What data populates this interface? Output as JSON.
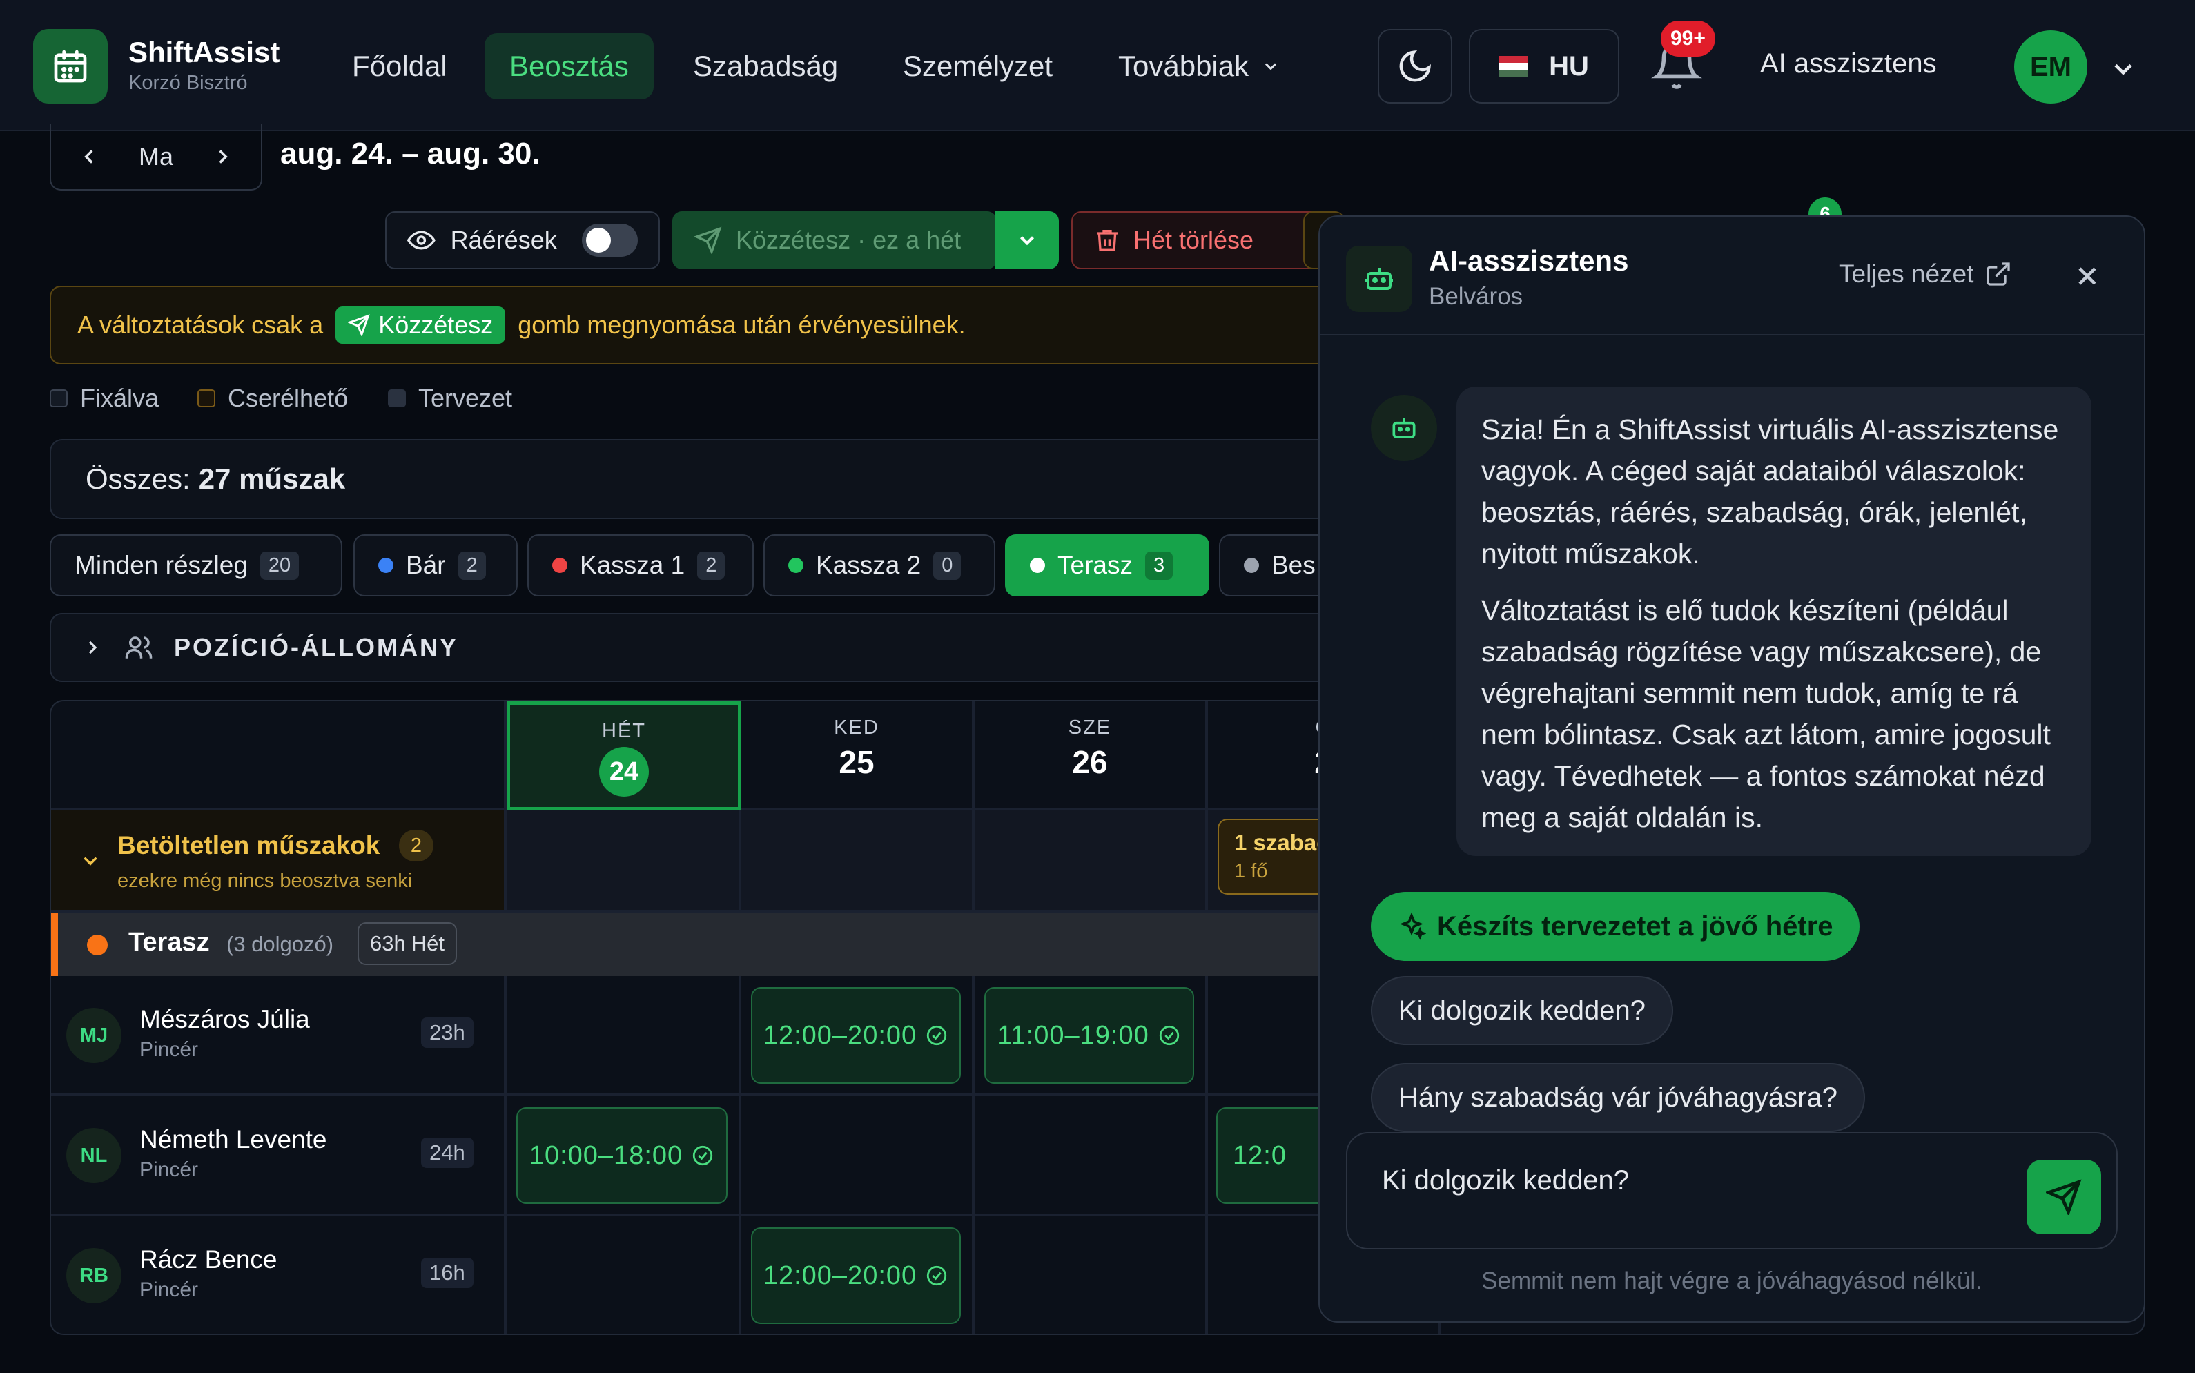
{
  "brand": {
    "name": "ShiftAssist",
    "subtitle": "Korzó Bisztró"
  },
  "nav": {
    "items": [
      {
        "label": "Főoldal"
      },
      {
        "label": "Beosztás",
        "active": true
      },
      {
        "label": "Szabadság"
      },
      {
        "label": "Személyzet"
      },
      {
        "label": "Továbbiak"
      }
    ],
    "language": "HU",
    "notifications_badge": "99+",
    "ai_link": "AI asszisztens",
    "avatar_initials": "EM"
  },
  "week": {
    "today_label": "Ma",
    "range": "aug. 24. – aug. 30."
  },
  "toolbar": {
    "availability": "Ráérések",
    "publish": "Közzétesz · ez a hét",
    "delete_week": "Hét törlése",
    "hidden_badge": "6"
  },
  "banner": {
    "before": "A változtatások csak a",
    "button": "Közzétesz",
    "after": "gomb megnyomása után érvényesülnek."
  },
  "legend": {
    "fixed": "Fixálva",
    "swappable": "Cserélhető",
    "draft": "Tervezet"
  },
  "summary": {
    "label": "Összes:",
    "value": "27 műszak"
  },
  "departments": [
    {
      "label": "Minden részleg",
      "count": "20"
    },
    {
      "label": "Bár",
      "count": "2",
      "color": "#3b82f6"
    },
    {
      "label": "Kassza 1",
      "count": "2",
      "color": "#ef4444"
    },
    {
      "label": "Kassza 2",
      "count": "0",
      "color": "#22c55e"
    },
    {
      "label": "Terasz",
      "count": "3",
      "color": "#ffffff",
      "active": true
    },
    {
      "label": "Bes",
      "color": "#9ca3af"
    }
  ],
  "position_section": {
    "label": "POZÍCIÓ-ÁLLOMÁNY"
  },
  "days": [
    {
      "name": "HÉT",
      "date": "24",
      "today": true
    },
    {
      "name": "KED",
      "date": "25"
    },
    {
      "name": "SZE",
      "date": "26"
    },
    {
      "name": "C",
      "date": "2"
    }
  ],
  "unfilled": {
    "title": "Betöltetlen műszakok",
    "count": "2",
    "subtitle": "ezekre még nincs beosztva senki",
    "card_title": "1 szabad",
    "card_sub": "1 fő"
  },
  "group": {
    "name": "Terasz",
    "staff": "(3 dolgozó)",
    "hours": "63h",
    "period": "Hét"
  },
  "employees": [
    {
      "initials": "MJ",
      "name": "Mészáros Júlia",
      "role": "Pincér",
      "hours": "23h",
      "shifts": [
        "",
        "12:00–20:00",
        "11:00–19:00",
        ""
      ]
    },
    {
      "initials": "NL",
      "name": "Németh Levente",
      "role": "Pincér",
      "hours": "24h",
      "shifts": [
        "10:00–18:00",
        "",
        "",
        "12:0"
      ]
    },
    {
      "initials": "RB",
      "name": "Rácz Bence",
      "role": "Pincér",
      "hours": "16h",
      "shifts": [
        "",
        "12:00–20:00",
        "",
        ""
      ]
    }
  ],
  "ai": {
    "title": "AI-asszisztens",
    "subtitle": "Belváros",
    "full_view": "Teljes nézet",
    "message_p1": "Szia! Én a ShiftAssist virtuális AI-asszisztense vagyok. A céged saját adataiból válaszolok: beosztás, ráérés, szabadság, órák, jelenlét, nyitott műszakok.",
    "message_p2": "Változtatást is elő tudok készíteni (például szabadság rögzítése vagy műszakcsere), de végrehajtani semmit nem tudok, amíg te rá nem bólintasz. Csak azt látom, amire jogosult vagy. Tévedhetek — a fontos számokat nézd meg a saját oldalán is.",
    "suggestions": [
      "Készíts tervezetet a jövő hétre",
      "Ki dolgozik kedden?",
      "Hány szabadság vár jóváhagyásra?"
    ],
    "input_value": "Ki dolgozik kedden?",
    "footer": "Semmit nem hajt végre a jóváhagyásod nélkül."
  },
  "colors": {
    "accent": "#16a34a",
    "accent_text": "#4ade80",
    "warning": "#f0c24a",
    "danger": "#f87171",
    "terasz": "#f97316"
  }
}
